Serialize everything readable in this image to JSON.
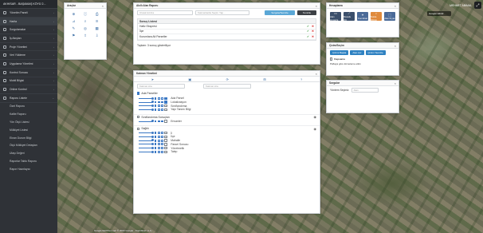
{
  "app": {
    "title": "AKHİSAR - BAŞAMAŞ KÖYÜ 2..."
  },
  "topbar": {
    "user": "MEHMET ABİMAL",
    "basemap": "Google Hibrid"
  },
  "sidebar": {
    "items": [
      {
        "label": "Yönetim Paneli"
      },
      {
        "label": "Harita",
        "active": true
      },
      {
        "label": "Sorgulamalar"
      },
      {
        "label": "İş Akışları"
      },
      {
        "label": "Proje Yönetimi"
      },
      {
        "label": "Veri Yükleme"
      },
      {
        "label": "Uygulama Yönetimi"
      },
      {
        "label": "Kontrol Sonucu"
      },
      {
        "label": "Mobil Bilgisi"
      },
      {
        "label": "Online Kontrol"
      },
      {
        "label": "Raporu Listele",
        "expanded": true
      }
    ],
    "subitems": [
      "Özel Raporu",
      "Kalite Raporu",
      "Yön Ölçü Listesi",
      "Mülkiyet Listesi",
      "Ekran Durum Bilgi",
      "Ölçü Mülkiyet Detayları",
      "Ulaşı Değeri",
      "Raporlar Tablo Raporu",
      "Rapor Hazırlayıcı"
    ]
  },
  "panels": {
    "tools": {
      "title": "Araçlar"
    },
    "search": {
      "title": "Akıllı Alan Raporu",
      "input_placeholder": "Ulusal Ad Ara",
      "select_placeholder": "Katmanlarda Seçim Yap...",
      "search_button": "Sorgula/Temizle",
      "clear_button": "Temizle",
      "results_header": "Sonuç Listesi",
      "results": [
        "Hafiz Ekspresi",
        "İlçe",
        "Kurumlara Ait Parseller"
      ],
      "summary": "Toplam: 3 sonuç gösteriliyor"
    },
    "layers": {
      "title": "Katman Yönetimi",
      "search_placeholder": "Katman Ara",
      "filter_placeholder": "Katman Ara",
      "group1": {
        "label": "Ada Parseller",
        "layers": [
          "Ada Parsel",
          "Lokalizasyon",
          "Sınıflandırma",
          "Yapı Tanımı Bilgi"
        ]
      },
      "group2": {
        "label": "Sınıflandırma Sonuçları",
        "layers": [
          "Envanter"
        ]
      },
      "group3": {
        "label": "Sağlık",
        "layers": [
          "İl",
          "İlçe",
          "Mahalle",
          "Parsel Sonucu",
          "Yönetmelik",
          "Talep"
        ]
      }
    },
    "draw": {
      "title": "Hesaplama",
      "buttons": [
        "Alan Hesapla",
        "Mesafe Ölç",
        "Koordinat",
        "Nokta Ölçüm",
        "Alan Kıyas"
      ]
    },
    "selection": {
      "title": "Çizim/Seçim",
      "buttons": [
        "Çizimi Başlat",
        "Alan Çiz",
        "Çizimi Temizle"
      ],
      "option_label": "Kapsama",
      "option_text": "Paftaya göre kümeleme etkin"
    },
    "queries": {
      "title": "Sorgular",
      "select_label": "Yöntem Seçiniz",
      "select_value": "Alan"
    }
  },
  "footer": {
    "text": "Google Earth'ten veri © 2022 Google · Koordinat: (1,1)"
  }
}
